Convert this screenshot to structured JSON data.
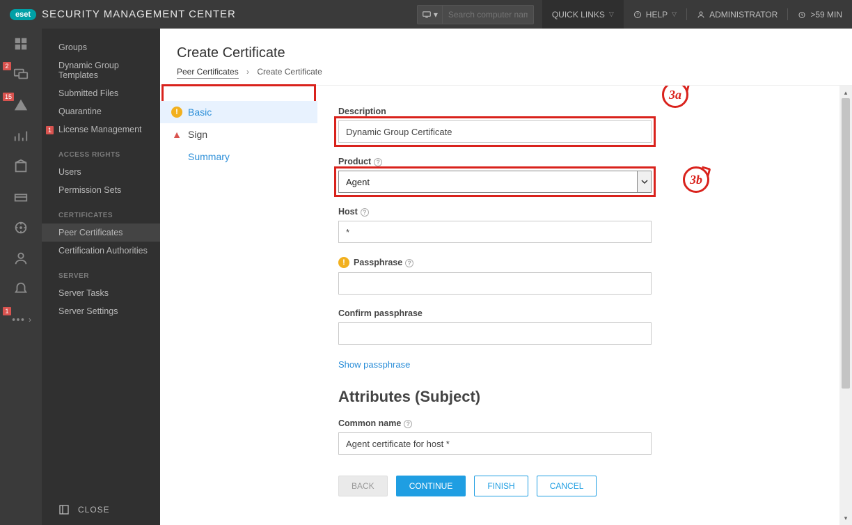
{
  "app": {
    "brand": "eset",
    "title": "SECURITY MANAGEMENT CENTER"
  },
  "topbar": {
    "search_placeholder": "Search computer name",
    "quick_links": "QUICK LINKS",
    "help": "HELP",
    "admin": "ADMINISTRATOR",
    "session": ">59 MIN"
  },
  "rail_badges": {
    "computers": "2",
    "warnings": "15",
    "more": "1"
  },
  "subnav": {
    "groups": "Groups",
    "dyn_tpl": "Dynamic Group Templates",
    "submitted": "Submitted Files",
    "quarantine": "Quarantine",
    "license": "License Management",
    "license_badge": "1",
    "h_access": "ACCESS RIGHTS",
    "users": "Users",
    "permsets": "Permission Sets",
    "h_certs": "CERTIFICATES",
    "peer_certs": "Peer Certificates",
    "cert_auth": "Certification Authorities",
    "h_server": "SERVER",
    "srv_tasks": "Server Tasks",
    "srv_settings": "Server Settings",
    "close": "CLOSE"
  },
  "page": {
    "title": "Create Certificate",
    "bc_root": "Peer Certificates",
    "bc_leaf": "Create Certificate"
  },
  "wizard": {
    "basic": "Basic",
    "sign": "Sign",
    "summary": "Summary"
  },
  "form": {
    "description_label": "Description",
    "description_value": "Dynamic Group Certificate",
    "product_label": "Product",
    "product_value": "Agent",
    "host_label": "Host",
    "host_value": "*",
    "passphrase_label": "Passphrase",
    "confirm_label": "Confirm passphrase",
    "show_pass": "Show passphrase",
    "attr_heading": "Attributes (Subject)",
    "common_name_label": "Common name",
    "common_name_value": "Agent certificate for host *"
  },
  "callouts": {
    "a": "3a",
    "b": "3b"
  },
  "buttons": {
    "back": "BACK",
    "continue": "CONTINUE",
    "finish": "FINISH",
    "cancel": "CANCEL"
  }
}
